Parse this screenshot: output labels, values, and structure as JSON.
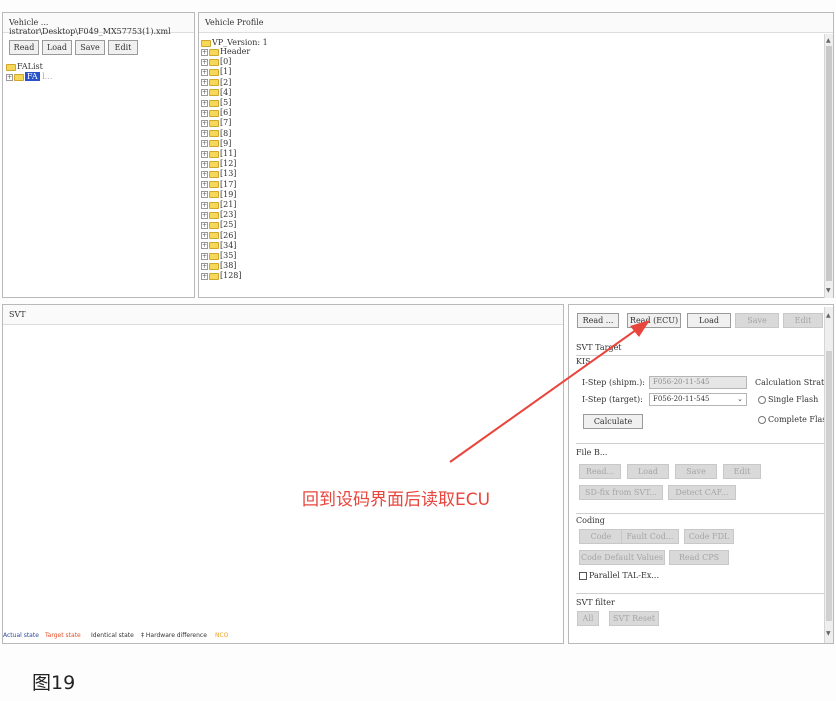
{
  "vehicle_panel": {
    "title": "Vehicle ... istrator\\Desktop\\F049_MX57753(1).xml",
    "buttons": {
      "read": "Read",
      "load": "Load",
      "save": "Save",
      "edit": "Edit"
    },
    "tree_root": "FAList",
    "tree_child_selected": "FA",
    "tree_child_extra": "l..."
  },
  "profile_panel": {
    "title": "Vehicle Profile",
    "root": "VP_Version: 1",
    "items": [
      "Header",
      "[0]",
      "[1]",
      "[2]",
      "[4]",
      "[5]",
      "[6]",
      "[7]",
      "[8]",
      "[9]",
      "[11]",
      "[12]",
      "[13]",
      "[17]",
      "[19]",
      "[21]",
      "[23]",
      "[25]",
      "[26]",
      "[34]",
      "[35]",
      "[38]",
      "[128]"
    ]
  },
  "svt_panel": {
    "title": "SVT",
    "legend": {
      "actual": "Actual state",
      "target": "Target state",
      "identical": "Identical state",
      "hardware": "Hardware difference",
      "nco": "NCO"
    },
    "colors": {
      "actual": "#2f4aa0",
      "target": "#e84f2a",
      "identical": "#333333",
      "hardware": "#333333",
      "nco": "#f0a020"
    }
  },
  "control_panel": {
    "top_buttons": {
      "read": "Read ...",
      "read_ecu": "Read (ECU)",
      "load": "Load",
      "save": "Save",
      "edit": "Edit"
    },
    "svt_target": "SVT Target",
    "kis": "KIS",
    "istep_ship_label": "I-Step (shipm.):",
    "istep_ship_value": "F056-20-11-545",
    "istep_target_label": "I-Step (target):",
    "istep_target_value": "F056-20-11-545",
    "calc_strategy": "Calculation Strate",
    "single_flash": "Single Flash",
    "complete_flash": "Complete Flash",
    "calculate": "Calculate",
    "file_section": "File B...",
    "file_buttons": {
      "read": "Read...",
      "load": "Load",
      "save": "Save",
      "edit": "Edit"
    },
    "file_row2": {
      "btn1": "SD-fix from SVT...",
      "btn2": "Detect CAF..."
    },
    "coding": "Coding",
    "coding_buttons": {
      "code": "Code",
      "fault": "Fault Cod...",
      "code_fdl": "Code FDL"
    },
    "coding_row2": {
      "btn1": "Code Default Values",
      "btn2": "Read CPS"
    },
    "parallel": "Parallel TAL-Ex...",
    "svt_filter": "SVT filter",
    "filter_buttons": {
      "all": "All",
      "reset": "SVT Reset"
    }
  },
  "annotation": {
    "text": "回到设码界面后读取ECU",
    "color": "#e8453c"
  },
  "caption": "图19"
}
